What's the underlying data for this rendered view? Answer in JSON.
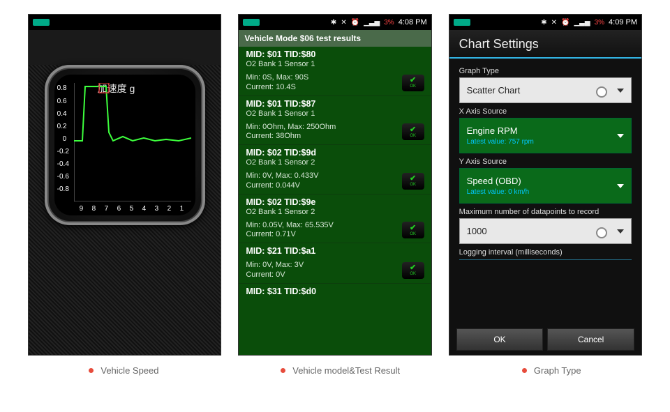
{
  "statusbar": {
    "battery_pct": "3%",
    "time1": "4:08 PM",
    "time2": "4:08 PM",
    "time3": "4:09 PM"
  },
  "panel1": {
    "gauge_title": "加速度 g",
    "yticks": [
      "0.8",
      "0.6",
      "0.4",
      "0.2",
      "0",
      "-0.2",
      "-0.4",
      "-0.6",
      "-0.8"
    ],
    "xticks": [
      "9",
      "8",
      "7",
      "6",
      "5",
      "4",
      "3",
      "2",
      "1"
    ]
  },
  "panel2": {
    "title": "Vehicle Mode $06 test results",
    "items": [
      {
        "header": "MID: $01 TID:$80",
        "sensor": "O2 Bank 1 Sensor 1",
        "minmax": "Min: 0S, Max: 90S",
        "current": "Current: 10.4S"
      },
      {
        "header": "MID: $01 TID:$87",
        "sensor": "O2 Bank 1 Sensor 1",
        "minmax": "Min: 0Ohm, Max: 250Ohm",
        "current": "Current: 38Ohm"
      },
      {
        "header": "MID: $02 TID:$9d",
        "sensor": "O2 Bank 1 Sensor 2",
        "minmax": "Min: 0V, Max: 0.433V",
        "current": "Current: 0.044V"
      },
      {
        "header": "MID: $02 TID:$9e",
        "sensor": "O2 Bank 1 Sensor 2",
        "minmax": "Min: 0.05V, Max: 65.535V",
        "current": "Current: 0.71V"
      },
      {
        "header": "MID: $21 TID:$a1",
        "sensor": "",
        "minmax": "Min: 0V, Max: 3V",
        "current": "Current: 0V"
      },
      {
        "header": "MID: $31 TID:$d0",
        "sensor": "",
        "minmax": "",
        "current": ""
      }
    ],
    "ok_label": "OK"
  },
  "panel3": {
    "title": "Chart Settings",
    "graph_type_label": "Graph Type",
    "graph_type_value": "Scatter Chart",
    "x_label": "X Axis Source",
    "x_value": "Engine RPM",
    "x_sub": "Latest value: 757 rpm",
    "y_label": "Y Axis Source",
    "y_value": "Speed (OBD)",
    "y_sub": "Latest value: 0 km/h",
    "max_label": "Maximum number of datapoints to record",
    "max_value": "1000",
    "log_label": "Logging interval (milliseconds)",
    "ok": "OK",
    "cancel": "Cancel"
  },
  "captions": {
    "c1": "Vehicle Speed",
    "c2": "Vehicle model&Test Result",
    "c3": "Graph Type"
  },
  "chart_data": {
    "type": "line",
    "title": "加速度 g",
    "xlabel": "",
    "ylabel": "",
    "x": [
      9,
      8,
      7,
      6,
      5,
      4,
      3,
      2,
      1
    ],
    "values": [
      0,
      0,
      0.9,
      0.9,
      0.1,
      0,
      0.05,
      0.02,
      0.05
    ],
    "ylim": [
      -0.9,
      0.9
    ]
  }
}
